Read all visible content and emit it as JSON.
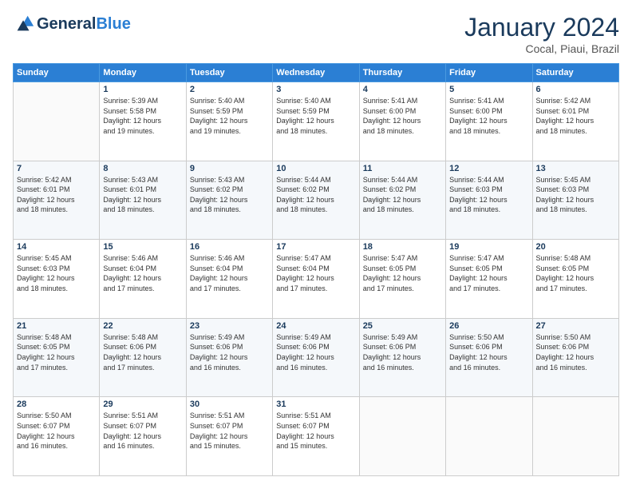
{
  "logo": {
    "line1": "General",
    "line2": "Blue"
  },
  "title": "January 2024",
  "subtitle": "Cocal, Piaui, Brazil",
  "days_of_week": [
    "Sunday",
    "Monday",
    "Tuesday",
    "Wednesday",
    "Thursday",
    "Friday",
    "Saturday"
  ],
  "weeks": [
    [
      {
        "day": "",
        "info": ""
      },
      {
        "day": "1",
        "info": "Sunrise: 5:39 AM\nSunset: 5:58 PM\nDaylight: 12 hours\nand 19 minutes."
      },
      {
        "day": "2",
        "info": "Sunrise: 5:40 AM\nSunset: 5:59 PM\nDaylight: 12 hours\nand 19 minutes."
      },
      {
        "day": "3",
        "info": "Sunrise: 5:40 AM\nSunset: 5:59 PM\nDaylight: 12 hours\nand 18 minutes."
      },
      {
        "day": "4",
        "info": "Sunrise: 5:41 AM\nSunset: 6:00 PM\nDaylight: 12 hours\nand 18 minutes."
      },
      {
        "day": "5",
        "info": "Sunrise: 5:41 AM\nSunset: 6:00 PM\nDaylight: 12 hours\nand 18 minutes."
      },
      {
        "day": "6",
        "info": "Sunrise: 5:42 AM\nSunset: 6:01 PM\nDaylight: 12 hours\nand 18 minutes."
      }
    ],
    [
      {
        "day": "7",
        "info": "Sunrise: 5:42 AM\nSunset: 6:01 PM\nDaylight: 12 hours\nand 18 minutes."
      },
      {
        "day": "8",
        "info": "Sunrise: 5:43 AM\nSunset: 6:01 PM\nDaylight: 12 hours\nand 18 minutes."
      },
      {
        "day": "9",
        "info": "Sunrise: 5:43 AM\nSunset: 6:02 PM\nDaylight: 12 hours\nand 18 minutes."
      },
      {
        "day": "10",
        "info": "Sunrise: 5:44 AM\nSunset: 6:02 PM\nDaylight: 12 hours\nand 18 minutes."
      },
      {
        "day": "11",
        "info": "Sunrise: 5:44 AM\nSunset: 6:02 PM\nDaylight: 12 hours\nand 18 minutes."
      },
      {
        "day": "12",
        "info": "Sunrise: 5:44 AM\nSunset: 6:03 PM\nDaylight: 12 hours\nand 18 minutes."
      },
      {
        "day": "13",
        "info": "Sunrise: 5:45 AM\nSunset: 6:03 PM\nDaylight: 12 hours\nand 18 minutes."
      }
    ],
    [
      {
        "day": "14",
        "info": "Sunrise: 5:45 AM\nSunset: 6:03 PM\nDaylight: 12 hours\nand 18 minutes."
      },
      {
        "day": "15",
        "info": "Sunrise: 5:46 AM\nSunset: 6:04 PM\nDaylight: 12 hours\nand 17 minutes."
      },
      {
        "day": "16",
        "info": "Sunrise: 5:46 AM\nSunset: 6:04 PM\nDaylight: 12 hours\nand 17 minutes."
      },
      {
        "day": "17",
        "info": "Sunrise: 5:47 AM\nSunset: 6:04 PM\nDaylight: 12 hours\nand 17 minutes."
      },
      {
        "day": "18",
        "info": "Sunrise: 5:47 AM\nSunset: 6:05 PM\nDaylight: 12 hours\nand 17 minutes."
      },
      {
        "day": "19",
        "info": "Sunrise: 5:47 AM\nSunset: 6:05 PM\nDaylight: 12 hours\nand 17 minutes."
      },
      {
        "day": "20",
        "info": "Sunrise: 5:48 AM\nSunset: 6:05 PM\nDaylight: 12 hours\nand 17 minutes."
      }
    ],
    [
      {
        "day": "21",
        "info": "Sunrise: 5:48 AM\nSunset: 6:05 PM\nDaylight: 12 hours\nand 17 minutes."
      },
      {
        "day": "22",
        "info": "Sunrise: 5:48 AM\nSunset: 6:06 PM\nDaylight: 12 hours\nand 17 minutes."
      },
      {
        "day": "23",
        "info": "Sunrise: 5:49 AM\nSunset: 6:06 PM\nDaylight: 12 hours\nand 16 minutes."
      },
      {
        "day": "24",
        "info": "Sunrise: 5:49 AM\nSunset: 6:06 PM\nDaylight: 12 hours\nand 16 minutes."
      },
      {
        "day": "25",
        "info": "Sunrise: 5:49 AM\nSunset: 6:06 PM\nDaylight: 12 hours\nand 16 minutes."
      },
      {
        "day": "26",
        "info": "Sunrise: 5:50 AM\nSunset: 6:06 PM\nDaylight: 12 hours\nand 16 minutes."
      },
      {
        "day": "27",
        "info": "Sunrise: 5:50 AM\nSunset: 6:06 PM\nDaylight: 12 hours\nand 16 minutes."
      }
    ],
    [
      {
        "day": "28",
        "info": "Sunrise: 5:50 AM\nSunset: 6:07 PM\nDaylight: 12 hours\nand 16 minutes."
      },
      {
        "day": "29",
        "info": "Sunrise: 5:51 AM\nSunset: 6:07 PM\nDaylight: 12 hours\nand 16 minutes."
      },
      {
        "day": "30",
        "info": "Sunrise: 5:51 AM\nSunset: 6:07 PM\nDaylight: 12 hours\nand 15 minutes."
      },
      {
        "day": "31",
        "info": "Sunrise: 5:51 AM\nSunset: 6:07 PM\nDaylight: 12 hours\nand 15 minutes."
      },
      {
        "day": "",
        "info": ""
      },
      {
        "day": "",
        "info": ""
      },
      {
        "day": "",
        "info": ""
      }
    ]
  ]
}
